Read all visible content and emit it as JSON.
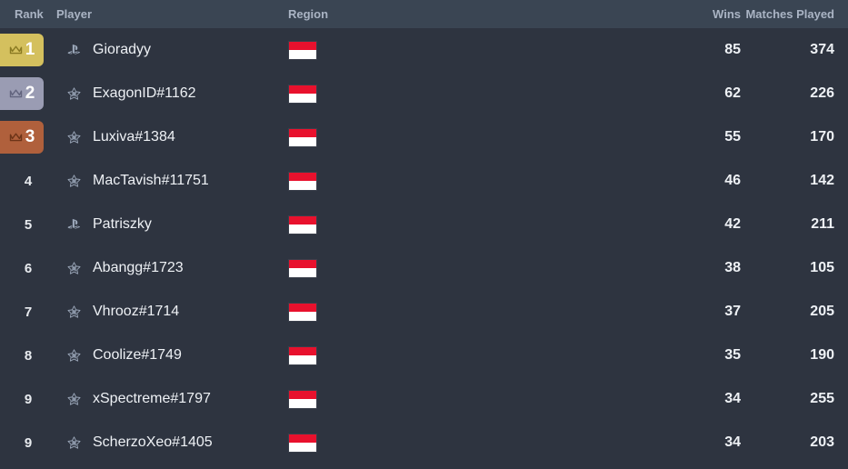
{
  "colors": {
    "header_bg": "#3a4553",
    "row_bg": "#2e3440",
    "header_text": "#aab4c4",
    "row_text": "#edf0f4",
    "gold": "#d4c05e",
    "silver": "#9a9cb3",
    "bronze": "#b0603c",
    "flag_red": "#e8112d",
    "flag_white": "#ffffff"
  },
  "header": {
    "rank": "Rank",
    "player": "Player",
    "region": "Region",
    "wins": "Wins",
    "matches": "Matches Played"
  },
  "rows": [
    {
      "rank": "1",
      "badge": "gold",
      "badge_icon": "crown-icon",
      "platform": "playstation-icon",
      "player": "Gioradyy",
      "region": "indonesia-flag",
      "wins": "85",
      "matches": "374"
    },
    {
      "rank": "2",
      "badge": "silver",
      "badge_icon": "crown-icon",
      "platform": "epic-games-icon",
      "player": "ExagonID#1162",
      "region": "indonesia-flag",
      "wins": "62",
      "matches": "226"
    },
    {
      "rank": "3",
      "badge": "bronze",
      "badge_icon": "crown-icon",
      "platform": "epic-games-icon",
      "player": "Luxiva#1384",
      "region": "indonesia-flag",
      "wins": "55",
      "matches": "170"
    },
    {
      "rank": "4",
      "badge": "none",
      "badge_icon": "",
      "platform": "epic-games-icon",
      "player": "MacTavish#11751",
      "region": "indonesia-flag",
      "wins": "46",
      "matches": "142"
    },
    {
      "rank": "5",
      "badge": "none",
      "badge_icon": "",
      "platform": "playstation-icon",
      "player": "Patriszky",
      "region": "indonesia-flag",
      "wins": "42",
      "matches": "211"
    },
    {
      "rank": "6",
      "badge": "none",
      "badge_icon": "",
      "platform": "epic-games-icon",
      "player": "Abangg#1723",
      "region": "indonesia-flag",
      "wins": "38",
      "matches": "105"
    },
    {
      "rank": "7",
      "badge": "none",
      "badge_icon": "",
      "platform": "epic-games-icon",
      "player": "Vhrooz#1714",
      "region": "indonesia-flag",
      "wins": "37",
      "matches": "205"
    },
    {
      "rank": "8",
      "badge": "none",
      "badge_icon": "",
      "platform": "epic-games-icon",
      "player": "Coolize#1749",
      "region": "indonesia-flag",
      "wins": "35",
      "matches": "190"
    },
    {
      "rank": "9",
      "badge": "none",
      "badge_icon": "",
      "platform": "epic-games-icon",
      "player": "xSpectreme#1797",
      "region": "indonesia-flag",
      "wins": "34",
      "matches": "255"
    },
    {
      "rank": "9",
      "badge": "none",
      "badge_icon": "",
      "platform": "epic-games-icon",
      "player": "ScherzoXeo#1405",
      "region": "indonesia-flag",
      "wins": "34",
      "matches": "203"
    }
  ]
}
